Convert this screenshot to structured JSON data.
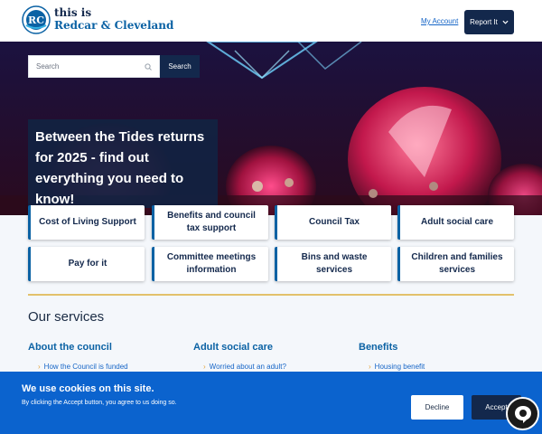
{
  "header": {
    "brand_line1": "this is",
    "brand_line2": "Redcar & Cleveland",
    "my_account": "My Account",
    "report_it": "Report It",
    "brand_color": "#13284c"
  },
  "search": {
    "placeholder": "Search",
    "button": "Search"
  },
  "hero": {
    "promo": "Between the Tides returns for 2025 - find out everything you need to know!"
  },
  "quick_links": [
    "Cost of Living Support",
    "Benefits and council tax support",
    "Council Tax",
    "Adult social care",
    "Pay for it",
    "Committee meetings information",
    "Bins and waste services",
    "Children and families services"
  ],
  "services": {
    "heading": "Our services",
    "columns": [
      {
        "title": "About the council",
        "link": "How the Council is funded"
      },
      {
        "title": "Adult social care",
        "link": "Worried about an adult?"
      },
      {
        "title": "Benefits",
        "link": "Housing benefit"
      }
    ]
  },
  "cookie": {
    "title": "We use cookies on this site.",
    "subtitle": "By clicking the Accept button, you agree to us doing so.",
    "decline": "Decline",
    "accept": "Accept",
    "banner_color": "#0b63ce"
  },
  "icons": {
    "logo": "council-logo",
    "search": "search-icon",
    "chevron": "chevron-down-icon",
    "chat": "chat-icon"
  }
}
